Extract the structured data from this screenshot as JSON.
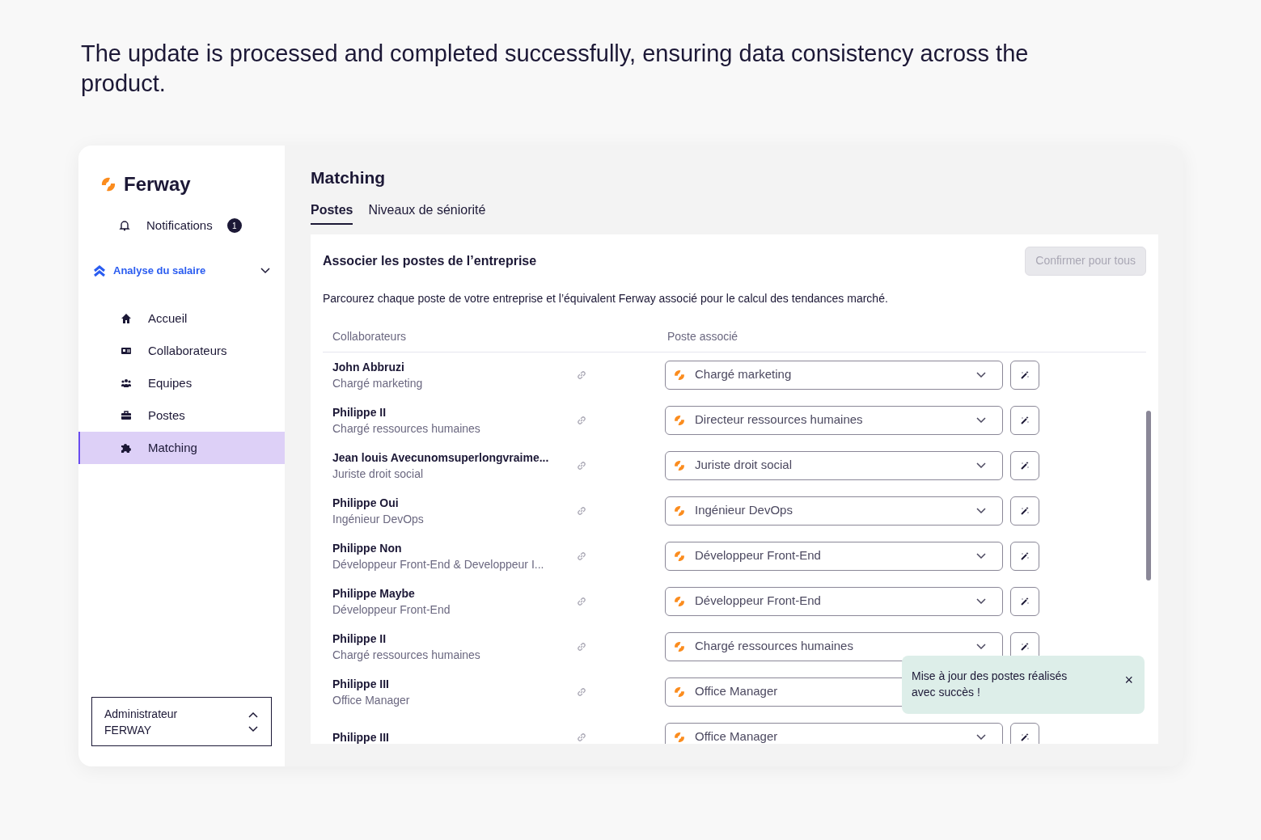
{
  "headline": "The update is processed and completed successfully, ensuring data consistency across the product.",
  "sidebar": {
    "logo": "Ferway",
    "notifications": {
      "label": "Notifications",
      "count": "1"
    },
    "section": {
      "label": "Analyse du salaire",
      "expanded": true
    },
    "items": [
      {
        "label": "Accueil",
        "kind": "home",
        "selected": false
      },
      {
        "label": "Collaborateurs",
        "kind": "card",
        "selected": false
      },
      {
        "label": "Equipes",
        "kind": "team",
        "selected": false
      },
      {
        "label": "Postes",
        "kind": "briefcase",
        "selected": false
      },
      {
        "label": "Matching",
        "kind": "puzzle",
        "selected": true
      }
    ],
    "account": {
      "line_1": "Administrateur",
      "line_2": "FERWAY"
    }
  },
  "page": {
    "title": "Matching",
    "tabs": [
      {
        "label": "Postes",
        "selected": true
      },
      {
        "label": "Niveaux de séniorité",
        "selected": false
      }
    ],
    "panel": {
      "title": "Associer les postes de l’entreprise",
      "confirm_button": {
        "label": "Confirmer pour tous",
        "disabled": true
      },
      "description": "Parcourez chaque poste de votre entreprise et l’équivalent Ferway associé pour le calcul des tendances marché.",
      "columns": [
        "Collaborateurs",
        "Poste associé"
      ],
      "rows": [
        {
          "name": "John Abbruzi",
          "job": "Chargé marketing",
          "poste": "Chargé marketing"
        },
        {
          "name": "Philippe II",
          "job": "Chargé ressources humaines",
          "poste": "Directeur ressources humaines"
        },
        {
          "name": "Jean louis Avecunomsuperlongvraime...",
          "job": "Juriste droit social",
          "poste": "Juriste droit social"
        },
        {
          "name": "Philippe Oui",
          "job": "Ingénieur DevOps",
          "poste": "Ingénieur DevOps"
        },
        {
          "name": "Philippe Non",
          "job": "Développeur Front-End & Developpeur I...",
          "poste": "Développeur Front-End"
        },
        {
          "name": "Philippe Maybe",
          "job": "Développeur Front-End",
          "poste": "Développeur Front-End"
        },
        {
          "name": "Philippe II",
          "job": "Chargé ressources humaines",
          "poste": "Chargé ressources humaines"
        },
        {
          "name": "Philippe III",
          "job": "Office Manager",
          "poste": "Office Manager"
        },
        {
          "name": "Philippe III",
          "poste": "Office Manager"
        }
      ]
    }
  },
  "toast": {
    "message": "Mise à jour des postes réalisés avec succès !",
    "close": "×"
  }
}
